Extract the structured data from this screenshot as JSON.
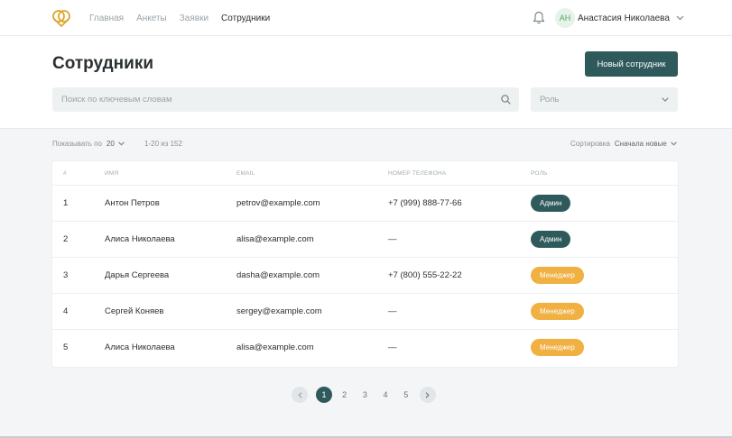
{
  "nav": {
    "items": [
      {
        "label": "Главная"
      },
      {
        "label": "Анкеты"
      },
      {
        "label": "Заявки"
      },
      {
        "label": "Сотрудники"
      }
    ],
    "active": "Сотрудники"
  },
  "user": {
    "initials": "АН",
    "name": "Анастасия Николаева"
  },
  "header": {
    "title": "Сотрудники",
    "new_button": "Новый сотрудник",
    "search_placeholder": "Поиск по ключевым словам",
    "role_placeholder": "Роль"
  },
  "toolbar": {
    "show_label": "Показывать по",
    "show_value": "20",
    "range": "1-20 из 152",
    "sort_label": "Сортировка",
    "sort_value": "Сначала новые"
  },
  "table": {
    "columns": [
      "#",
      "ИМЯ",
      "EMAIL",
      "НОМЕР ТЕЛЕФОНА",
      "РОЛЬ"
    ],
    "rows": [
      {
        "num": "1",
        "name": "Антон Петров",
        "email": "petrov@example.com",
        "phone": "+7 (999) 888-77-66",
        "role": "Админ",
        "role_type": "admin"
      },
      {
        "num": "2",
        "name": "Алиса Николаева",
        "email": "alisa@example.com",
        "phone": "—",
        "role": "Админ",
        "role_type": "admin"
      },
      {
        "num": "3",
        "name": "Дарья Сергеева",
        "email": "dasha@example.com",
        "phone": "+7 (800) 555-22-22",
        "role": "Менеджер",
        "role_type": "manager"
      },
      {
        "num": "4",
        "name": "Сергей Коняев",
        "email": "sergey@example.com",
        "phone": "—",
        "role": "Менеджер",
        "role_type": "manager"
      },
      {
        "num": "5",
        "name": "Алиса Николаева",
        "email": "alisa@example.com",
        "phone": "—",
        "role": "Менеджер",
        "role_type": "manager"
      }
    ]
  },
  "pagination": {
    "pages": [
      "1",
      "2",
      "3",
      "4",
      "5"
    ],
    "current": "1"
  },
  "colors": {
    "brand_dark": "#2f5a5b",
    "manager_badge": "#f0b042",
    "logo_accent": "#e0a52e"
  },
  "icons": {
    "logo": "logo-icon",
    "bell": "bell-icon",
    "user_dropdown": "chevron-down-icon",
    "search": "search-icon",
    "role_dropdown": "chevron-down-icon",
    "prev": "chevron-left-icon",
    "next": "chevron-right-icon"
  }
}
